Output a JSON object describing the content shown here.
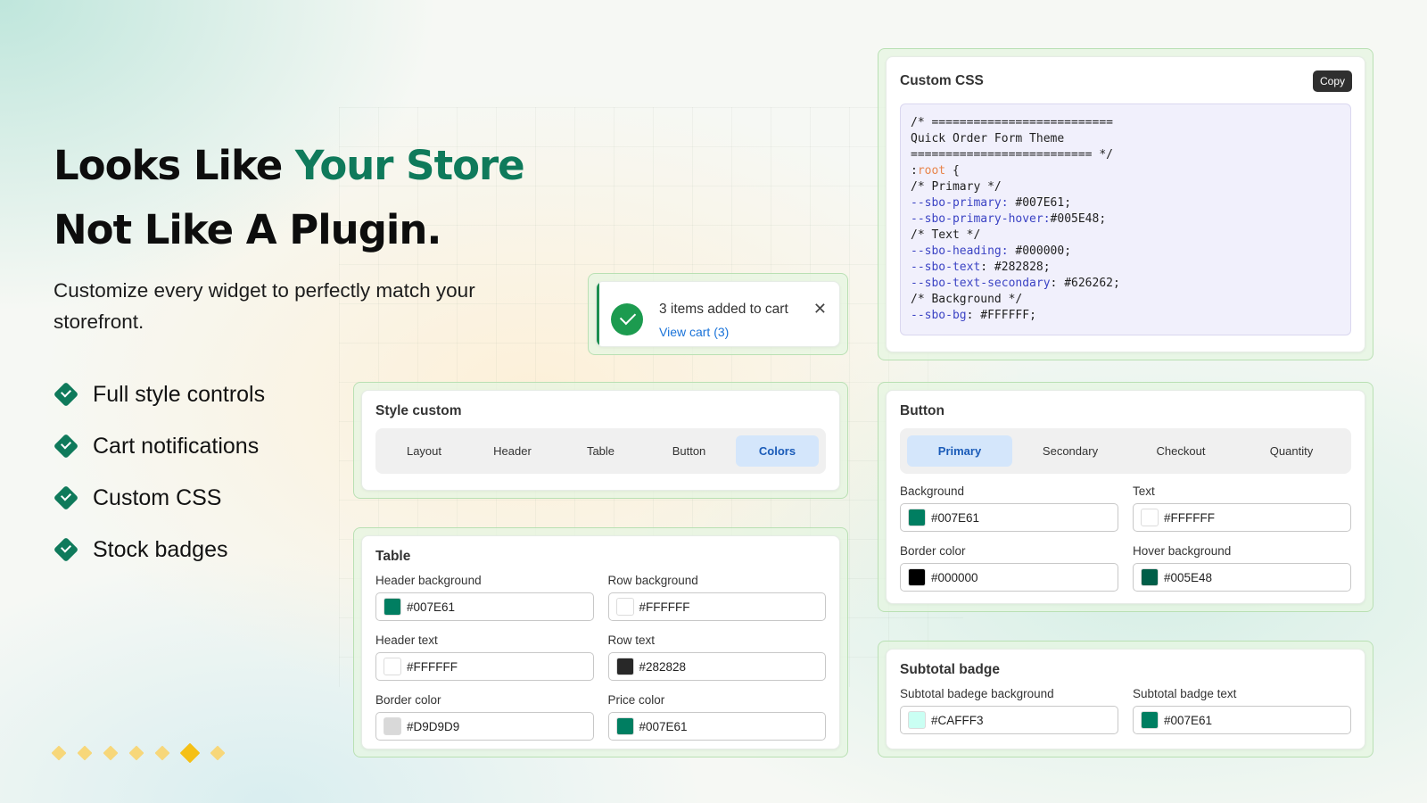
{
  "hero": {
    "line1_prefix": "Looks Like ",
    "line1_accent": "Your Store",
    "line2": "Not Like A Plugin.",
    "subtitle": "Customize every widget to perfectly match your storefront."
  },
  "features": [
    "Full style controls",
    "Cart notifications",
    "Custom CSS",
    "Stock badges"
  ],
  "toast": {
    "message": "3 items added to cart",
    "link": "View cart (3)",
    "close": "✕"
  },
  "style_custom": {
    "title": "Style custom",
    "tabs": [
      "Layout",
      "Header",
      "Table",
      "Button",
      "Colors"
    ],
    "active_tab": "Colors"
  },
  "table_panel": {
    "title": "Table",
    "fields": [
      {
        "label": "Header background",
        "value": "#007E61"
      },
      {
        "label": "Row background",
        "value": "#FFFFFF"
      },
      {
        "label": "Header text",
        "value": "#FFFFFF"
      },
      {
        "label": "Row text",
        "value": "#282828"
      },
      {
        "label": "Border color",
        "value": "#D9D9D9"
      },
      {
        "label": "Price color",
        "value": "#007E61"
      }
    ]
  },
  "css_panel": {
    "title": "Custom CSS",
    "copy_label": "Copy",
    "lines": [
      {
        "parts": [
          {
            "t": "/* ==========================",
            "c": ""
          }
        ]
      },
      {
        "parts": [
          {
            "t": "Quick Order Form Theme",
            "c": ""
          }
        ]
      },
      {
        "parts": [
          {
            "t": "========================== */",
            "c": ""
          }
        ]
      },
      {
        "parts": [
          {
            "t": ":",
            "c": ""
          },
          {
            "t": "root",
            "c": "root"
          },
          {
            "t": " {",
            "c": ""
          }
        ]
      },
      {
        "parts": [
          {
            "t": "/* Primary */",
            "c": ""
          }
        ]
      },
      {
        "parts": [
          {
            "t": "--sbo-primary:",
            "c": "var"
          },
          {
            "t": " #007E61;",
            "c": ""
          }
        ]
      },
      {
        "parts": [
          {
            "t": "--sbo-primary-hover:",
            "c": "var"
          },
          {
            "t": "#005E48;",
            "c": ""
          }
        ]
      },
      {
        "parts": [
          {
            "t": "/* Text */",
            "c": ""
          }
        ]
      },
      {
        "parts": [
          {
            "t": "--sbo-heading:",
            "c": "var"
          },
          {
            "t": " #000000;",
            "c": ""
          }
        ]
      },
      {
        "parts": [
          {
            "t": "--sbo-text",
            "c": "var"
          },
          {
            "t": ": #282828;",
            "c": ""
          }
        ]
      },
      {
        "parts": [
          {
            "t": "--sbo-text-secondary",
            "c": "var"
          },
          {
            "t": ": #626262;",
            "c": ""
          }
        ]
      },
      {
        "parts": [
          {
            "t": "/* Background */",
            "c": ""
          }
        ]
      },
      {
        "parts": [
          {
            "t": "--sbo-bg",
            "c": "var"
          },
          {
            "t": ": #FFFFFF;",
            "c": ""
          }
        ]
      }
    ]
  },
  "button_panel": {
    "title": "Button",
    "tabs": [
      "Primary",
      "Secondary",
      "Checkout",
      "Quantity"
    ],
    "active_tab": "Primary",
    "fields": [
      {
        "label": "Background",
        "value": "#007E61"
      },
      {
        "label": "Text",
        "value": "#FFFFFF"
      },
      {
        "label": "Border color",
        "value": "#000000"
      },
      {
        "label": "Hover background",
        "value": "#005E48"
      }
    ]
  },
  "subtotal_panel": {
    "title": "Subtotal badge",
    "fields": [
      {
        "label": "Subtotal badege background",
        "value": "#CAFFF3"
      },
      {
        "label": "Subtotal badge text",
        "value": "#007E61"
      }
    ]
  },
  "carousel": {
    "count": 7,
    "active_index": 5
  },
  "colors": {
    "brand": "#0F7A5B",
    "active_tab_bg": "#D4E6FB",
    "success": "#1C9B4F",
    "link": "#1A73D9",
    "dot": "#F7D77A",
    "dot_active": "#F5C016"
  }
}
